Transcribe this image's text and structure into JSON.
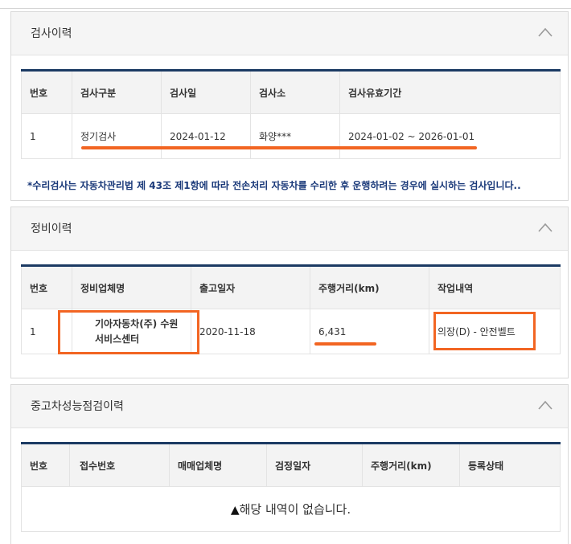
{
  "inspection": {
    "title": "검사이력",
    "headers": [
      "번호",
      "검사구분",
      "검사일",
      "검사소",
      "검사유효기간"
    ],
    "row": {
      "no": "1",
      "type": "정기검사",
      "date": "2024-01-12",
      "station": "화양***",
      "validity": "2024-01-02 ~ 2026-01-01"
    },
    "note": "*수리검사는 자동차관리법 제 43조 제1항에 따라 전손처리 자동차를 수리한 후 운행하려는 경우에 실시하는 검사입니다.."
  },
  "maintenance": {
    "title": "정비이력",
    "headers": [
      "번호",
      "정비업체명",
      "출고일자",
      "주행거리(km)",
      "작업내역"
    ],
    "row": {
      "no": "1",
      "shop": "기아자동차(주) 수원서비스센터",
      "release_date": "2020-11-18",
      "mileage": "6,431",
      "work": "의장(D) - 안전벨트"
    }
  },
  "used_car": {
    "title": "중고차성능점검이력",
    "headers": [
      "번호",
      "접수번호",
      "매매업체명",
      "검정일자",
      "주행거리(km)",
      "등록상태"
    ],
    "empty_message": "해당 내역이 없습니다.",
    "empty_icon": "warning-icon"
  },
  "colors": {
    "accent": "#f26522",
    "header_border": "#1b3a63",
    "note_text": "#1b3a7a"
  }
}
